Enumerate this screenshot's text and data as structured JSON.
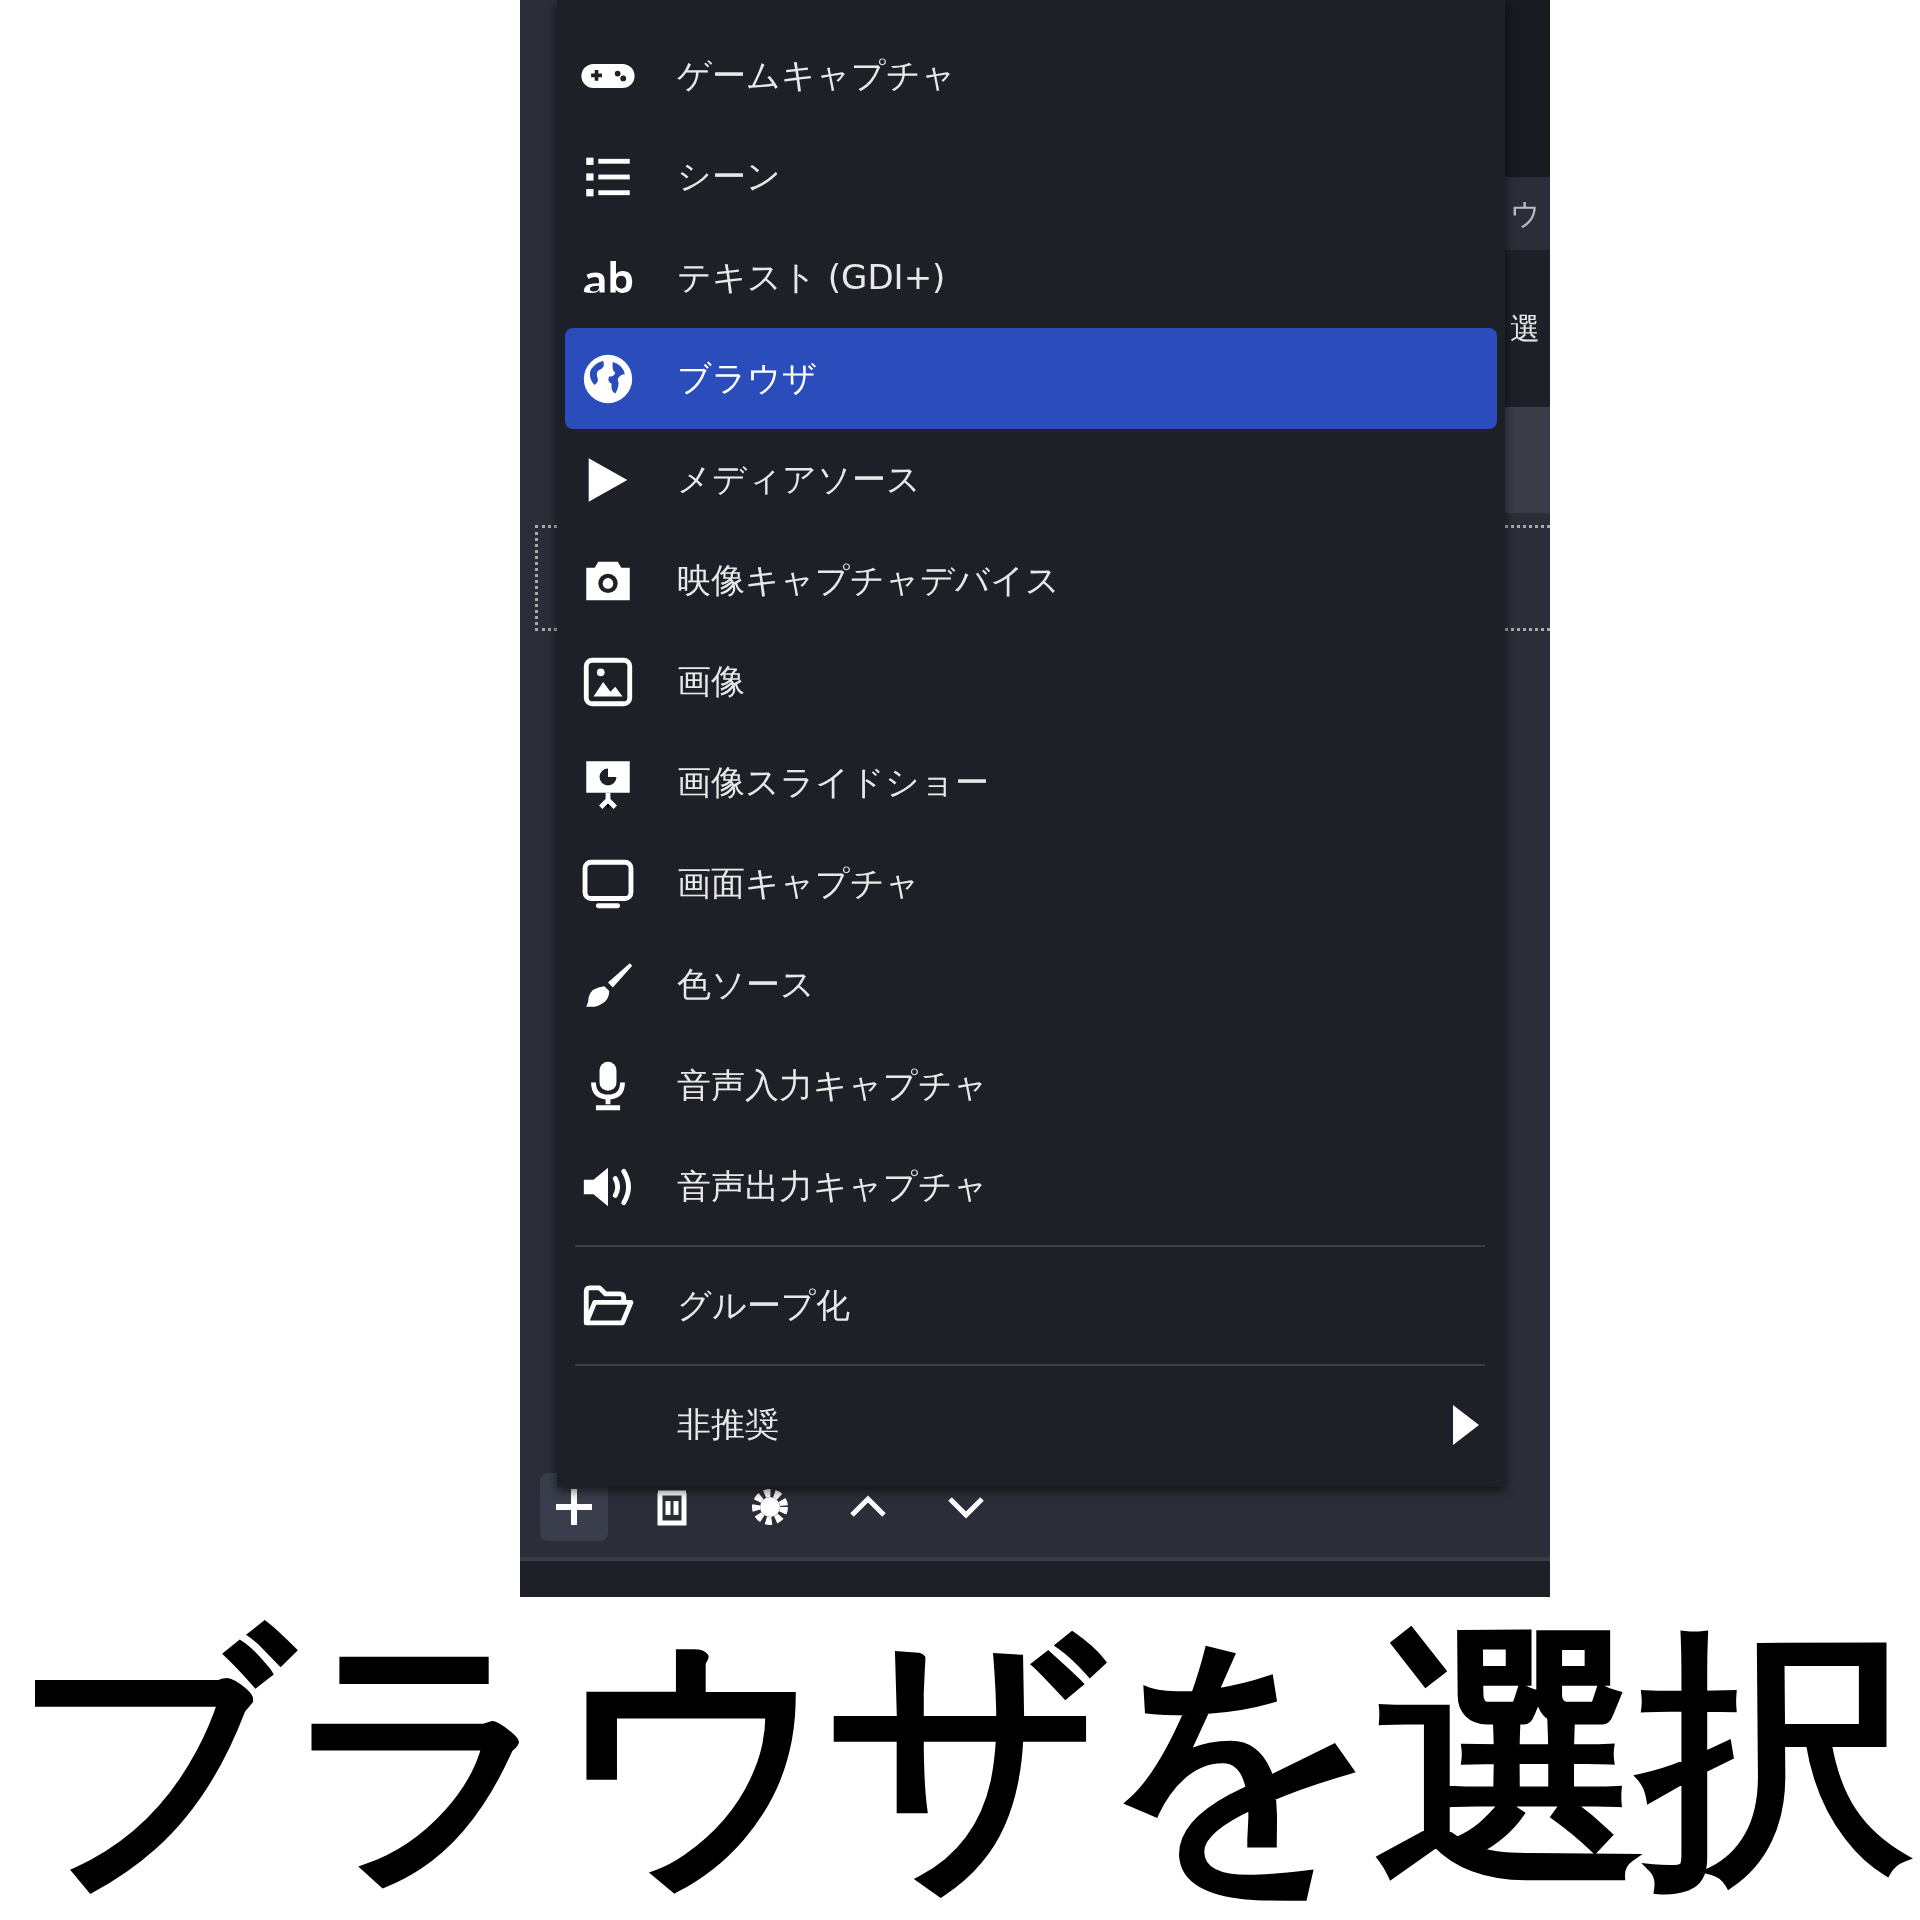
{
  "menu": {
    "items": [
      {
        "kind": "item",
        "label": "ゲームキャプチャ",
        "selected": false
      },
      {
        "kind": "item",
        "label": "シーン",
        "selected": false
      },
      {
        "kind": "item",
        "label": "テキスト (GDI+)",
        "selected": false
      },
      {
        "kind": "item",
        "label": "ブラウザ",
        "selected": true
      },
      {
        "kind": "item",
        "label": "メディアソース",
        "selected": false
      },
      {
        "kind": "item",
        "label": "映像キャプチャデバイス",
        "selected": false
      },
      {
        "kind": "item",
        "label": "画像",
        "selected": false
      },
      {
        "kind": "item",
        "label": "画像スライドショー",
        "selected": false
      },
      {
        "kind": "item",
        "label": "画面キャプチャ",
        "selected": false
      },
      {
        "kind": "item",
        "label": "色ソース",
        "selected": false
      },
      {
        "kind": "item",
        "label": "音声入力キャプチャ",
        "selected": false
      },
      {
        "kind": "item",
        "label": "音声出力キャプチャ",
        "selected": false
      },
      {
        "kind": "separator"
      },
      {
        "kind": "item",
        "label": "グループ化",
        "selected": false
      },
      {
        "kind": "separator"
      },
      {
        "kind": "submenu",
        "label": "非推奨",
        "selected": false
      }
    ]
  },
  "background": {
    "fragments": [
      "ウ",
      "選"
    ]
  },
  "caption": "ブラウザを選択"
}
